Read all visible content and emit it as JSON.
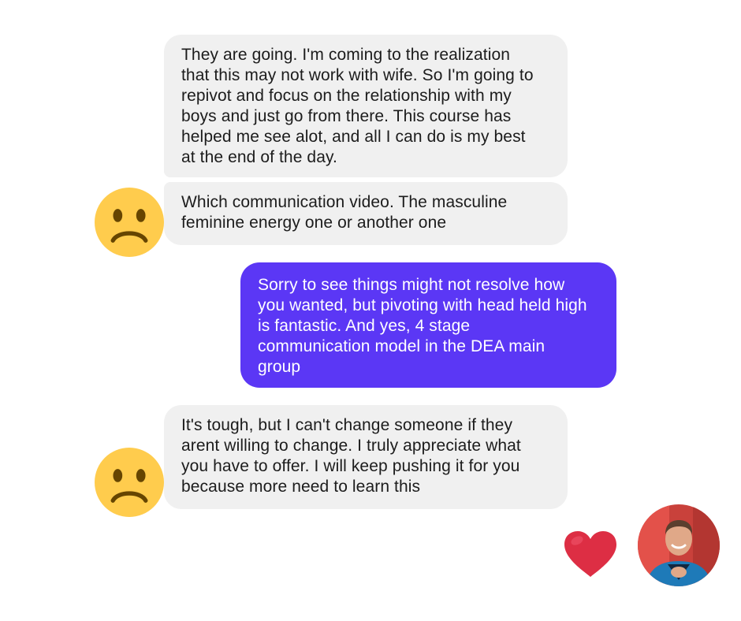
{
  "conversation": {
    "messages": [
      {
        "sender": "contact",
        "text": "They are going. I'm coming to the realization\nthat this may not work with wife. So I'm going to\nrepivot and focus on the relationship with my\nboys and just go from there.  This course has\nhelped me see alot, and all I can do is my best\nat the end of the day."
      },
      {
        "sender": "contact",
        "text": "Which communication video. The masculine\nfeminine energy one or another one",
        "avatar_icon": "frowning-face-icon"
      },
      {
        "sender": "me",
        "text": "Sorry to see things might not resolve how\nyou wanted, but pivoting with head held high\nis fantastic. And yes, 4 stage\ncommunication model in the DEA main\ngroup"
      },
      {
        "sender": "contact",
        "text": "It's tough, but I can't change someone if they\narent willing to change.  I truly appreciate what\nyou have to offer. I will keep pushing it for you\nbecause more need to learn this",
        "avatar_icon": "frowning-face-icon"
      }
    ],
    "reaction": {
      "icon": "red-heart-icon"
    },
    "my_avatar": {
      "icon": "profile-photo"
    }
  },
  "colors": {
    "incoming_bubble": "#f0f0f0",
    "outgoing_bubble": "#5b37f5",
    "incoming_text": "#1c1c1c",
    "outgoing_text": "#ffffff",
    "emoji_face": "#ffcc4d",
    "heart": "#dd2e44"
  }
}
